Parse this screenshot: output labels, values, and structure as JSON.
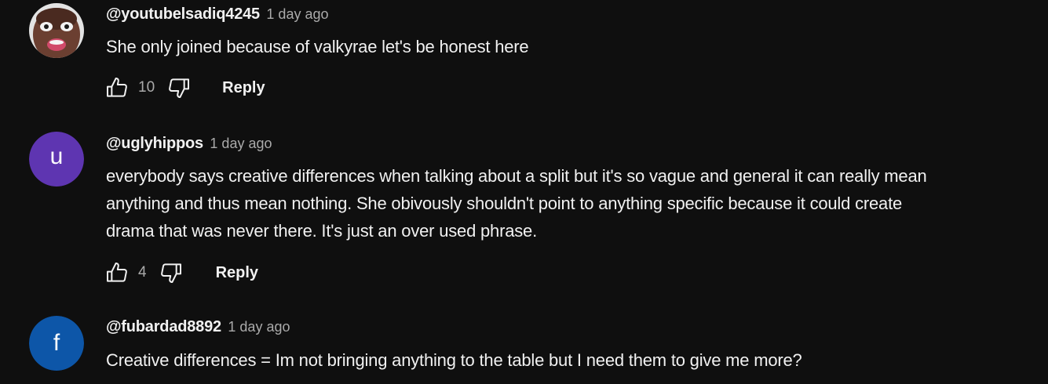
{
  "comments": [
    {
      "author": "@youtubelsadiq4245",
      "time": "1 day ago",
      "text": "She only joined because of valkyrae let's be honest here",
      "likes": "10",
      "reply_label": "Reply",
      "avatar_color": "#c0707a"
    },
    {
      "author": "@uglyhippos",
      "time": "1 day ago",
      "text": "everybody says creative differences when talking about a split but it's so vague and general it can really mean anything and thus mean nothing. She obivously shouldn't point to anything specific because it could create drama that was never there. It's just an over used phrase.",
      "likes": "4",
      "reply_label": "Reply",
      "avatar_letter": "u",
      "avatar_color": "#5e35b1"
    },
    {
      "author": "@fubardad8892",
      "time": "1 day ago",
      "text": "Creative differences = Im not bringing anything to the table but I need them to give me more?",
      "avatar_letter": "f",
      "avatar_color": "#0d56a8"
    }
  ],
  "colors": {
    "background": "#0f0f0f",
    "primary_text": "#f1f1f1",
    "secondary_text": "#aaaaaa"
  },
  "icons": {
    "like": "thumbs-up-icon",
    "dislike": "thumbs-down-icon"
  }
}
